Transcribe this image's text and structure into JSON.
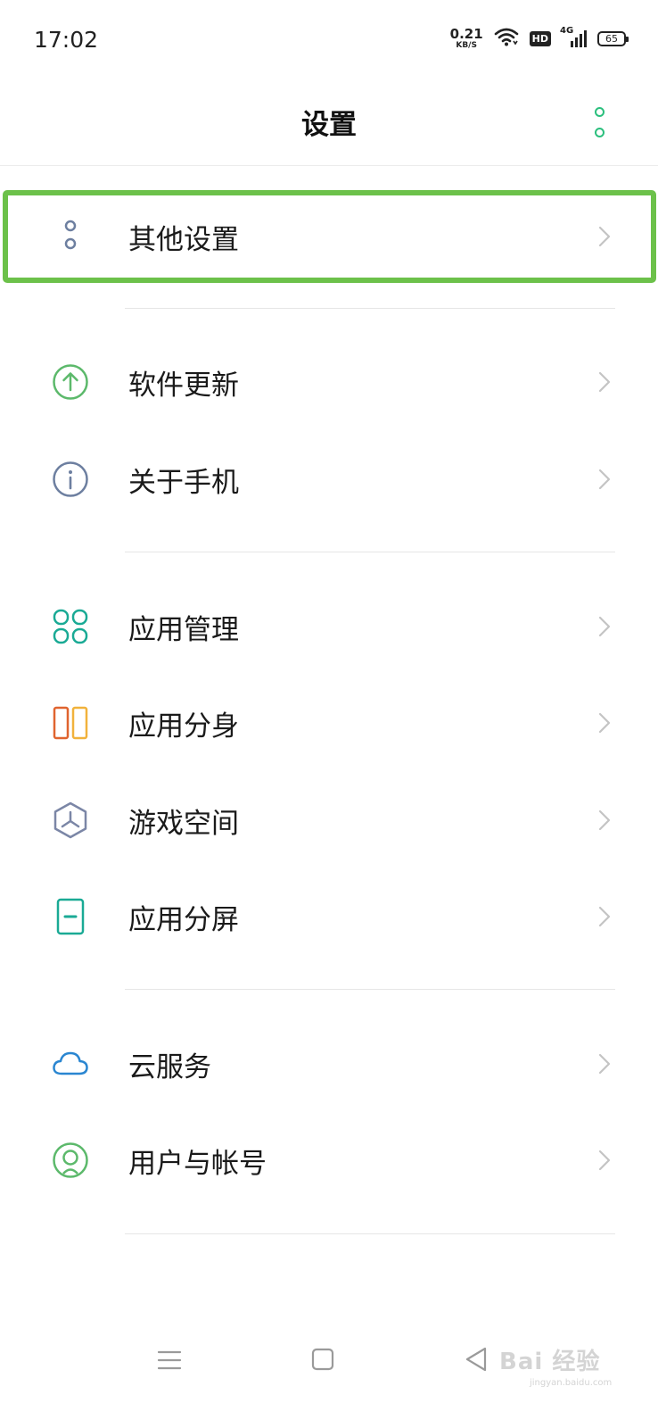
{
  "status_bar": {
    "time": "17:02",
    "net_speed_value": "0.21",
    "net_speed_unit": "KB/S",
    "hd": "HD",
    "network": "4G",
    "battery": "65"
  },
  "header": {
    "title": "设置",
    "more_icon": "more-vertical-icon",
    "accent_color": "#2bbf7d"
  },
  "highlight_color": "#6cc14a",
  "sections": [
    {
      "items": [
        {
          "label": "其他设置",
          "icon": "more-circles-icon"
        }
      ]
    },
    {
      "items": [
        {
          "label": "软件更新",
          "icon": "arrow-up-circle-icon"
        },
        {
          "label": "关于手机",
          "icon": "info-circle-icon"
        }
      ]
    },
    {
      "items": [
        {
          "label": "应用管理",
          "icon": "app-grid-icon"
        },
        {
          "label": "应用分身",
          "icon": "clone-icon"
        },
        {
          "label": "游戏空间",
          "icon": "hexagon-icon"
        },
        {
          "label": "应用分屏",
          "icon": "split-screen-icon"
        }
      ]
    },
    {
      "items": [
        {
          "label": "云服务",
          "icon": "cloud-icon"
        },
        {
          "label": "用户与帐号",
          "icon": "user-circle-icon"
        }
      ]
    }
  ],
  "nav_bar": {
    "menu_icon": "menu-icon",
    "home_icon": "home-square-icon",
    "back_icon": "back-triangle-icon"
  },
  "watermark": {
    "text": "Bai 经验",
    "sub": "jingyan.baidu.com"
  }
}
